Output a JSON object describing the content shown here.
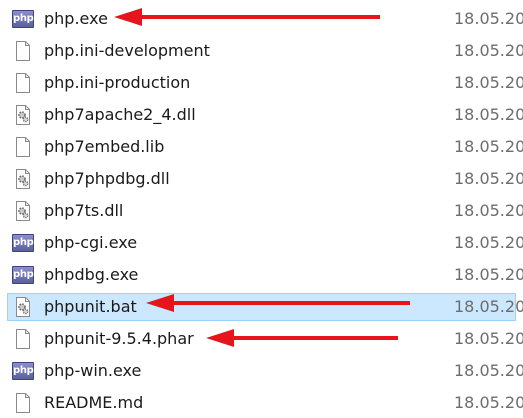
{
  "files": [
    {
      "name": "php.exe",
      "date": "18.05.20",
      "icon": "php-exe-icon",
      "selected": false,
      "arrow": true
    },
    {
      "name": "php.ini-development",
      "date": "18.05.20",
      "icon": "blank-file-icon",
      "selected": false,
      "arrow": false
    },
    {
      "name": "php.ini-production",
      "date": "18.05.20",
      "icon": "blank-file-icon",
      "selected": false,
      "arrow": false
    },
    {
      "name": "php7apache2_4.dll",
      "date": "18.05.20",
      "icon": "dll-gear-file-icon",
      "selected": false,
      "arrow": false
    },
    {
      "name": "php7embed.lib",
      "date": "18.05.20",
      "icon": "blank-file-icon",
      "selected": false,
      "arrow": false
    },
    {
      "name": "php7phpdbg.dll",
      "date": "18.05.20",
      "icon": "dll-gear-file-icon",
      "selected": false,
      "arrow": false
    },
    {
      "name": "php7ts.dll",
      "date": "18.05.20",
      "icon": "dll-gear-file-icon",
      "selected": false,
      "arrow": false
    },
    {
      "name": "php-cgi.exe",
      "date": "18.05.20",
      "icon": "php-exe-icon",
      "selected": false,
      "arrow": false
    },
    {
      "name": "phpdbg.exe",
      "date": "18.05.20",
      "icon": "php-exe-icon",
      "selected": false,
      "arrow": false
    },
    {
      "name": "phpunit.bat",
      "date": "18.05.20",
      "icon": "bat-gear-file-icon",
      "selected": true,
      "arrow": true
    },
    {
      "name": "phpunit-9.5.4.phar",
      "date": "18.05.20",
      "icon": "blank-file-icon",
      "selected": false,
      "arrow": true
    },
    {
      "name": "php-win.exe",
      "date": "18.05.20",
      "icon": "php-exe-icon",
      "selected": false,
      "arrow": false
    },
    {
      "name": "README.md",
      "date": "18.05.20",
      "icon": "blank-file-icon",
      "selected": false,
      "arrow": false
    }
  ],
  "php_badge_text": "php",
  "colors": {
    "arrow": "#e8141b",
    "selection_fill": "#cce8ff",
    "selection_border": "#99d1ff",
    "date_text": "#6d6d6d"
  }
}
